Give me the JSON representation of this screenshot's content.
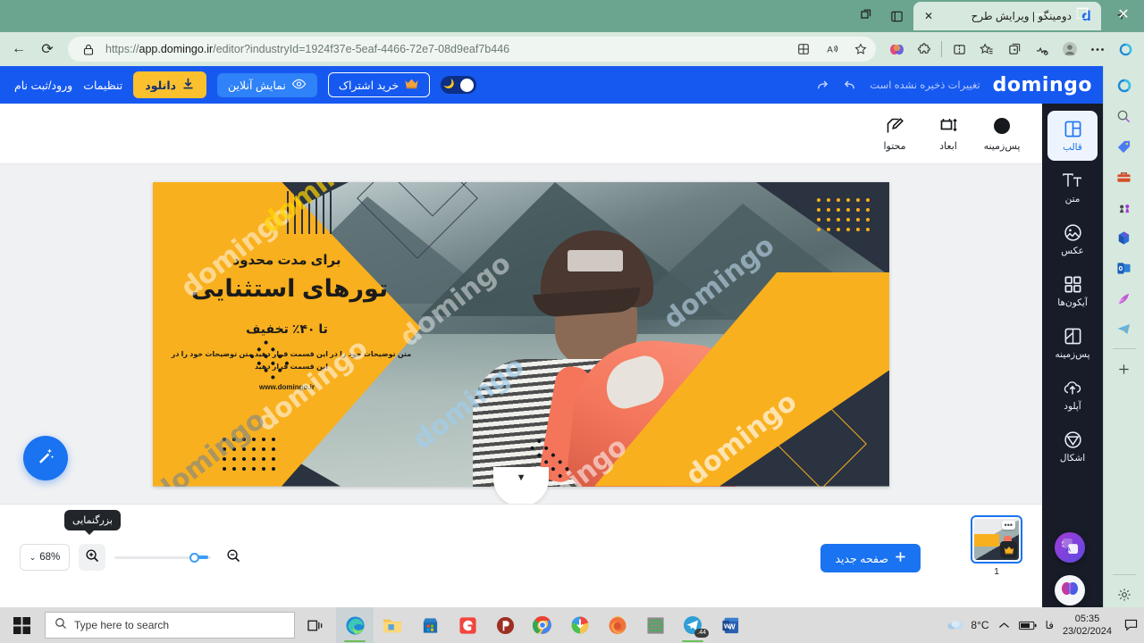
{
  "browser": {
    "tab": {
      "title": "دومینگو | ویرایش طرح",
      "favicon": "domingo-d-icon",
      "close": "✕"
    },
    "new_tab_label": "+",
    "window_controls": {
      "minimize": "—",
      "maximize": "❐",
      "close": "✕"
    },
    "nav": {
      "back": "←",
      "reload": "⟳"
    },
    "omnibox": {
      "lock_icon": "lock-icon",
      "url_main": "https://app.domingo.ir/editor?industryId=1924f37e-5eaf-4466-72e7-08d9eaf7b446",
      "url_scheme": "https://",
      "url_host": "app.domingo.ir",
      "url_path": "/editor?industryId=1924f37e-5eaf-4466-72e7-08d9eaf7b446",
      "split_icon": "split-screen-icon",
      "read_aloud_icon": "read-aloud-icon",
      "favorite_icon": "star-icon"
    },
    "toolbar_right": [
      "copilot-icon",
      "extensions-icon",
      "split-screen-icon",
      "collections-icon",
      "favorites-icon",
      "browser-essentials-icon",
      "profile-icon",
      "settings-more-icon",
      "copilot-sidebar-icon"
    ],
    "sidebar_icons": [
      "search-icon",
      "shopping-icon",
      "tools-icon",
      "games-icon",
      "microsoft365-icon",
      "outlook-icon",
      "image-creator-icon",
      "telegram-icon",
      "add-icon",
      "gear-icon"
    ]
  },
  "app_header": {
    "logo": "domingo",
    "save_status": "تغییرات ذخیره نشده است",
    "undo_icon": "undo-icon",
    "redo_icon": "redo-icon",
    "theme_toggle": {
      "moon_icon": "moon-icon",
      "state": "light"
    },
    "subscribe_label": "خرید اشتراک",
    "subscribe_icon": "crown-icon",
    "preview_label": "نمایش آنلاین",
    "preview_icon": "eye-icon",
    "download_label": "دانلود",
    "download_icon": "download-icon",
    "settings_label": "تنظیمات",
    "login_label": "ورود/ثبت نام"
  },
  "left_toolbar": [
    {
      "label": "پس‌زمینه",
      "icon": "color-circle-icon"
    },
    {
      "label": "ابعاد",
      "icon": "dimensions-icon"
    },
    {
      "label": "محتوا",
      "icon": "edit-content-icon"
    }
  ],
  "app_sidebar": {
    "items": [
      {
        "label": "قالب",
        "icon": "template-icon",
        "active": true
      },
      {
        "label": "متن",
        "icon": "text-icon",
        "active": false
      },
      {
        "label": "عکس",
        "icon": "image-icon",
        "active": false
      },
      {
        "label": "آیکون‌ها",
        "icon": "icons-grid-icon",
        "active": false
      },
      {
        "label": "پس‌زمینه",
        "icon": "background-icon",
        "active": false
      },
      {
        "label": "آپلود",
        "icon": "upload-cloud-icon",
        "active": false
      },
      {
        "label": "اشکال",
        "icon": "shapes-icon",
        "active": false
      }
    ],
    "floating": [
      {
        "name": "translate-button",
        "icon": "translate-icon"
      },
      {
        "name": "ai-assistant-button",
        "icon": "ai-brain-icon"
      }
    ]
  },
  "canvas": {
    "eyebrow": "برای مدت محدود",
    "headline": "تورهای استثنایی",
    "discount": "تا ۴۰٪ تخفیف",
    "body": "متن توضیحات خود را در این قسمت قرار دهید متن توضیحات خود را در این قسمت قرار دهید",
    "url": "www.domingo.ir",
    "watermark": "domingo",
    "magic_button_icon": "magic-wand-icon",
    "collapse_icon": "chevron-down-icon",
    "colors": {
      "yellow": "#f9b01e",
      "dark": "#2b3340",
      "accent_pink": "#f4765c"
    }
  },
  "bottom_bar": {
    "zoom_value": "68%",
    "zoom_dropdown_icon": "chevron-down-icon",
    "zoom_in_icon": "zoom-in-icon",
    "zoom_out_icon": "zoom-out-icon",
    "tooltip": "بزرگنمایی",
    "new_page_label": "صفحه جدید",
    "new_page_icon": "plus-icon",
    "page_thumb": {
      "number": "1",
      "menu_icon": "more-icon",
      "badge_icon": "crown-icon"
    }
  },
  "taskbar": {
    "start_icon": "windows-start-icon",
    "search_placeholder": "Type here to search",
    "search_icon": "search-icon",
    "taskview_icon": "task-view-icon",
    "apps": [
      {
        "name": "edge",
        "icon": "edge-icon",
        "active": true
      },
      {
        "name": "file-explorer",
        "icon": "folder-icon"
      },
      {
        "name": "microsoft-store",
        "icon": "store-icon"
      },
      {
        "name": "camtasia",
        "icon": "camtasia-icon"
      },
      {
        "name": "photoscape",
        "icon": "photoscape-icon"
      },
      {
        "name": "chrome",
        "icon": "chrome-icon"
      },
      {
        "name": "internet-download-manager",
        "icon": "idm-icon"
      },
      {
        "name": "firefox",
        "icon": "firefox-icon"
      },
      {
        "name": "notepad",
        "icon": "notepad-icon"
      },
      {
        "name": "telegram",
        "icon": "telegram-icon",
        "badge": ".44"
      },
      {
        "name": "word",
        "icon": "word-icon"
      }
    ],
    "tray": {
      "weather_temp": "8°C",
      "weather_icon": "cloud-icon",
      "chevron_icon": "chevron-up-icon",
      "battery_icon": "battery-icon",
      "language": "فا",
      "time": "05:35",
      "date": "23/02/2024",
      "notification_icon": "notification-icon"
    }
  }
}
